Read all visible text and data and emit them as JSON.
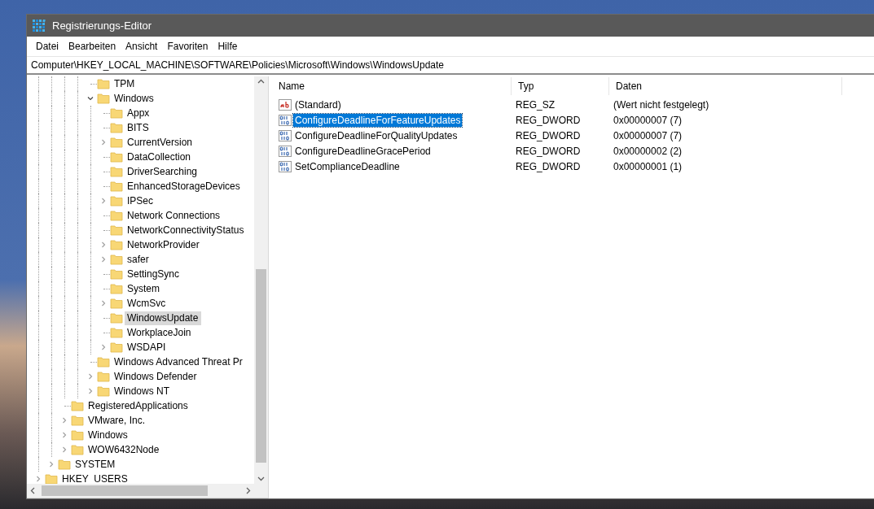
{
  "window": {
    "title": "Registrierungs-Editor"
  },
  "menu": [
    "Datei",
    "Bearbeiten",
    "Ansicht",
    "Favoriten",
    "Hilfe"
  ],
  "address": "Computer\\HKEY_LOCAL_MACHINE\\SOFTWARE\\Policies\\Microsoft\\Windows\\WindowsUpdate",
  "tree": [
    {
      "children": [
        {
          "children": [
            {
              "children": [
                {
                  "children": [
                    {
                      "label": "TPM",
                      "kind": "leaf",
                      "selected": false
                    },
                    {
                      "label": "Windows",
                      "kind": "branch",
                      "expanded": true,
                      "selected": false,
                      "children": [
                        {
                          "label": "Appx",
                          "kind": "leaf",
                          "selected": false
                        },
                        {
                          "label": "BITS",
                          "kind": "leaf",
                          "selected": false
                        },
                        {
                          "label": "CurrentVersion",
                          "kind": "branch",
                          "expanded": false,
                          "selected": false
                        },
                        {
                          "label": "DataCollection",
                          "kind": "leaf",
                          "selected": false
                        },
                        {
                          "label": "DriverSearching",
                          "kind": "leaf",
                          "selected": false
                        },
                        {
                          "label": "EnhancedStorageDevices",
                          "kind": "leaf",
                          "selected": false
                        },
                        {
                          "label": "IPSec",
                          "kind": "branch",
                          "expanded": false,
                          "selected": false
                        },
                        {
                          "label": "Network Connections",
                          "kind": "leaf",
                          "selected": false
                        },
                        {
                          "label": "NetworkConnectivityStatus",
                          "kind": "leaf",
                          "selected": false
                        },
                        {
                          "label": "NetworkProvider",
                          "kind": "branch",
                          "expanded": false,
                          "selected": false
                        },
                        {
                          "label": "safer",
                          "kind": "branch",
                          "expanded": false,
                          "selected": false
                        },
                        {
                          "label": "SettingSync",
                          "kind": "leaf",
                          "selected": false
                        },
                        {
                          "label": "System",
                          "kind": "leaf",
                          "selected": false
                        },
                        {
                          "label": "WcmSvc",
                          "kind": "branch",
                          "expanded": false,
                          "selected": false
                        },
                        {
                          "label": "WindowsUpdate",
                          "kind": "leaf",
                          "selected": true
                        },
                        {
                          "label": "WorkplaceJoin",
                          "kind": "leaf",
                          "selected": false
                        },
                        {
                          "label": "WSDAPI",
                          "kind": "branch",
                          "expanded": false,
                          "selected": false
                        }
                      ]
                    },
                    {
                      "label": "Windows Advanced Threat Pr",
                      "kind": "leaf",
                      "selected": false
                    },
                    {
                      "label": "Windows Defender",
                      "kind": "branch",
                      "expanded": false,
                      "selected": false
                    },
                    {
                      "label": "Windows NT",
                      "kind": "branch",
                      "expanded": false,
                      "selected": false
                    }
                  ]
                }
              ]
            },
            {
              "label": "RegisteredApplications",
              "kind": "leaf",
              "selected": false
            },
            {
              "label": "VMware, Inc.",
              "kind": "branch",
              "expanded": false,
              "selected": false
            },
            {
              "label": "Windows",
              "kind": "branch",
              "expanded": false,
              "selected": false
            },
            {
              "label": "WOW6432Node",
              "kind": "branch",
              "expanded": false,
              "selected": false
            }
          ]
        },
        {
          "label": "SYSTEM",
          "kind": "branch",
          "expanded": false,
          "selected": false
        }
      ]
    },
    {
      "label": "HKEY_USERS",
      "kind": "branch",
      "expanded": false,
      "selected": false
    }
  ],
  "values": {
    "columns": [
      "Name",
      "Typ",
      "Daten"
    ],
    "rows": [
      {
        "kind": "sz",
        "name": "(Standard)",
        "type": "REG_SZ",
        "data": "(Wert nicht festgelegt)",
        "selected": false
      },
      {
        "kind": "dword",
        "name": "ConfigureDeadlineForFeatureUpdates",
        "type": "REG_DWORD",
        "data": "0x00000007 (7)",
        "selected": true
      },
      {
        "kind": "dword",
        "name": "ConfigureDeadlineForQualityUpdates",
        "type": "REG_DWORD",
        "data": "0x00000007 (7)",
        "selected": false
      },
      {
        "kind": "dword",
        "name": "ConfigureDeadlineGracePeriod",
        "type": "REG_DWORD",
        "data": "0x00000002 (2)",
        "selected": false
      },
      {
        "kind": "dword",
        "name": "SetComplianceDeadline",
        "type": "REG_DWORD",
        "data": "0x00000001 (1)",
        "selected": false
      }
    ]
  }
}
